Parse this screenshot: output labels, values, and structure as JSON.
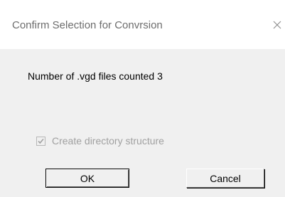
{
  "dialog": {
    "title": "Confirm Selection for Convrsion",
    "close_icon": "close-icon",
    "message": "Number of .vgd files counted 3",
    "checkbox": {
      "label": "Create directory structure",
      "checked": true,
      "disabled": true
    },
    "buttons": {
      "ok_label": "OK",
      "cancel_label": "Cancel"
    }
  },
  "colors": {
    "titlebar_bg": "#ffffff",
    "title_text": "#6d6d6d",
    "dialog_bg": "#f0f0f0",
    "disabled_text": "#a0a0a0"
  }
}
